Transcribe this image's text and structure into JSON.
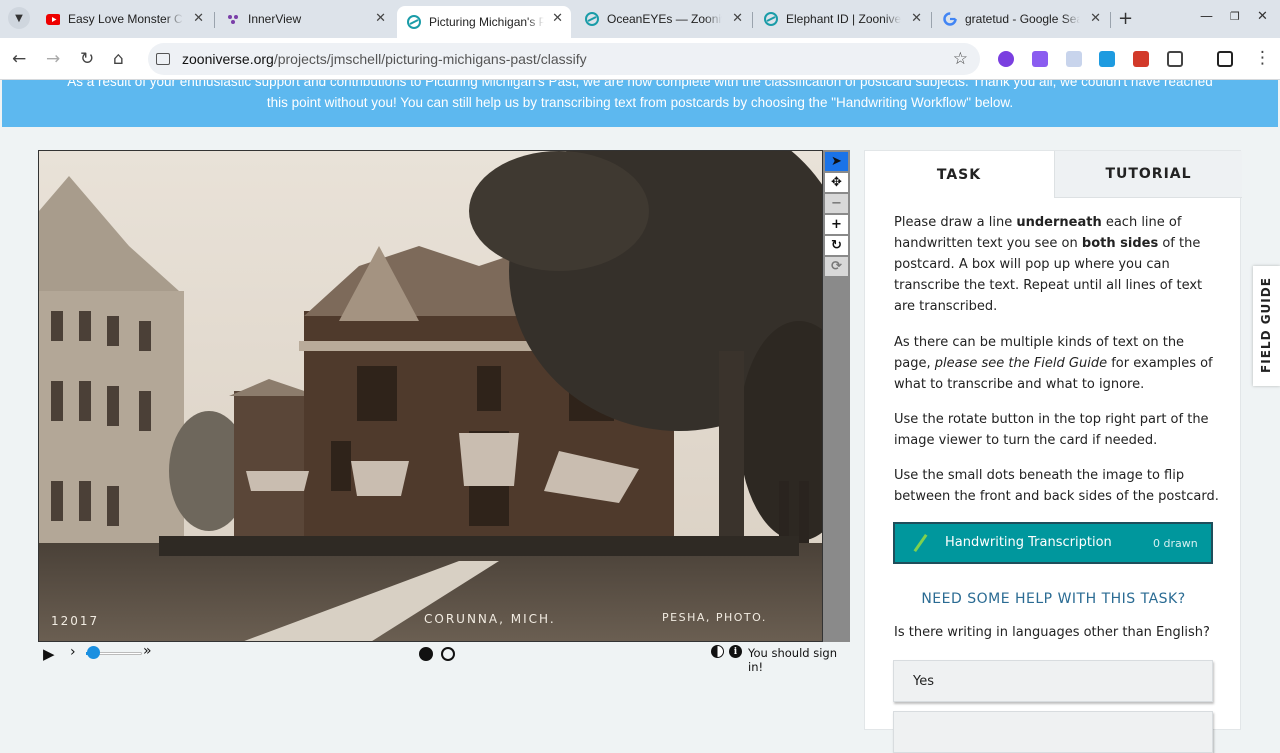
{
  "browser": {
    "tabs": [
      {
        "title": "Easy Love Monster Ca",
        "icon": "youtube-icon"
      },
      {
        "title": "InnerView",
        "icon": "innerview-icon"
      },
      {
        "title": "Picturing Michigan's P",
        "icon": "zooniverse-icon",
        "active": true
      },
      {
        "title": "OceanEYEs — Zoonive",
        "icon": "zooniverse-icon"
      },
      {
        "title": "Elephant ID | Zooniver",
        "icon": "zooniverse-icon"
      },
      {
        "title": "gratetud - Google Sear",
        "icon": "google-icon"
      }
    ],
    "url_host": "zooniverse.org",
    "url_path": "/projects/jmschell/picturing-michigans-past/classify"
  },
  "banner": {
    "line1": "As a result of your enthusiastic support and contributions to Picturing Michigan's Past, we are now complete with the classification of postcard subjects. Thank you all, we couldn't have reached",
    "line2": "this point without you! You can still help us by transcribing text from postcards by choosing the \"Handwriting Workflow\" below."
  },
  "postcard": {
    "number": "12017",
    "place": "CORUNNA, MICH.",
    "credit": "PESHA, PHOTO."
  },
  "controls": {
    "signin_text": "You should sign in!"
  },
  "panel": {
    "tab_task": "TASK",
    "tab_tutorial": "TUTORIAL",
    "p1_a": "Please draw a line ",
    "p1_b": "underneath",
    "p1_c": " each line of handwritten text you see on ",
    "p1_d": "both sides",
    "p1_e": " of the postcard. A box will pop up where you can transcribe the text. Repeat until all lines of text are transcribed.",
    "p2_a": "As there can be multiple kinds of text on the page, ",
    "p2_b": "please see the Field Guide",
    "p2_c": " for examples of what to transcribe and what to ignore.",
    "p3": "Use the rotate button in the top right part of the image viewer to turn the card if needed.",
    "p4": "Use the small dots beneath the image to flip between the front and back sides of the postcard.",
    "tool_label": "Handwriting Transcription",
    "tool_count": "0 drawn",
    "help_link": "NEED SOME HELP WITH THIS TASK?",
    "question": "Is there writing in languages other than English?",
    "answer_yes": "Yes"
  },
  "field_guide": "FIELD GUIDE",
  "colors": {
    "banner": "#5db8ef",
    "tool_button": "#00979d",
    "help_link": "#2a6b93"
  }
}
